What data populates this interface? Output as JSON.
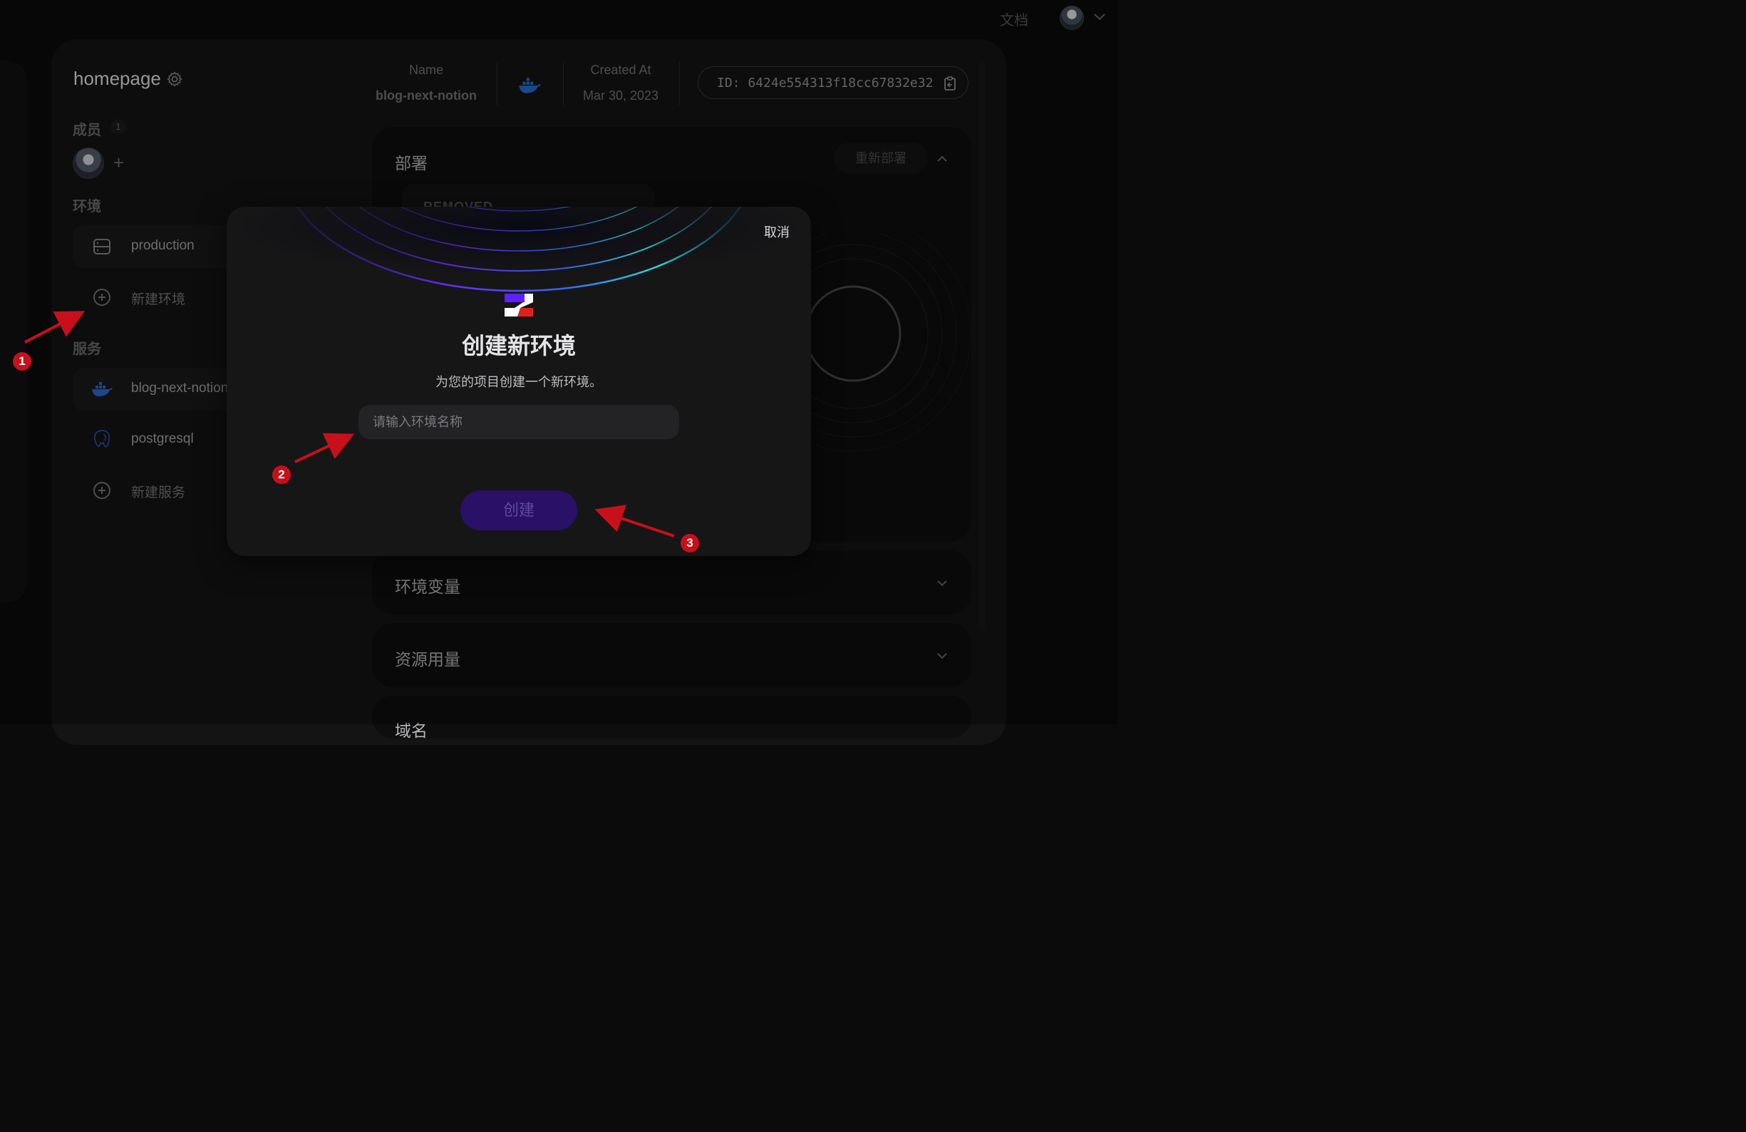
{
  "topbar": {
    "docs_label": "文档"
  },
  "project": {
    "title": "homepage"
  },
  "members": {
    "label": "成员",
    "count": "1"
  },
  "environments": {
    "label": "环境",
    "items": [
      {
        "label": "production"
      }
    ],
    "new_label": "新建环境"
  },
  "services": {
    "label": "服务",
    "items": [
      {
        "label": "blog-next-notion"
      },
      {
        "label": "postgresql"
      }
    ],
    "new_label": "新建服务"
  },
  "service_header": {
    "name_label": "Name",
    "name_value": "blog-next-notion",
    "created_label": "Created At",
    "created_value": "Mar 30, 2023",
    "id_text": "ID: 6424e554313f18cc67832e32"
  },
  "panels": {
    "deploy": {
      "title": "部署",
      "redeploy_label": "重新部署",
      "tab_text": "REMOVED"
    },
    "env_vars": {
      "title": "环境变量"
    },
    "resources": {
      "title": "资源用量"
    },
    "domains": {
      "title": "域名"
    }
  },
  "modal": {
    "cancel_label": "取消",
    "title": "创建新环境",
    "subtitle": "为您的项目创建一个新环境。",
    "input_placeholder": "请输入环境名称",
    "create_label": "创建"
  },
  "annotations": {
    "step1": "1",
    "step2": "2",
    "step3": "3"
  },
  "colors": {
    "accent_purple": "#5b21ff",
    "annotation_red": "#c8101a",
    "docker_blue": "#2a6fd6"
  }
}
